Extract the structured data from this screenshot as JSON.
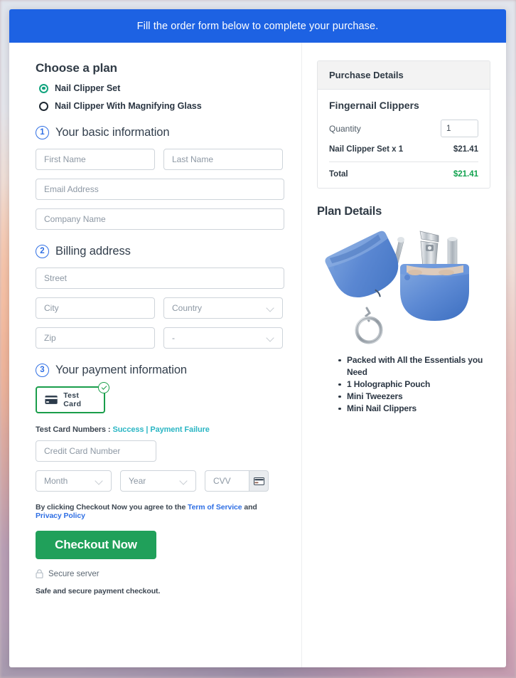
{
  "banner": {
    "text": "Fill the order form below to complete your purchase."
  },
  "colors": {
    "banner_blue": "#1d62e3",
    "accent_blue": "#2f6fe4",
    "success_green": "#20a05a",
    "total_green": "#12a34f",
    "radio_green": "#12a47e",
    "link_teal": "#2bb6c4",
    "tile_border_green": "#1a9e4b"
  },
  "plan": {
    "title": "Choose a plan",
    "options": [
      {
        "label": "Nail Clipper Set",
        "selected": true
      },
      {
        "label": "Nail Clipper With Magnifying Glass",
        "selected": false
      }
    ]
  },
  "step1": {
    "number": "1",
    "label": "Your basic information",
    "fields": {
      "first_name": "First Name",
      "last_name": "Last Name",
      "email": "Email Address",
      "company": "Company Name"
    }
  },
  "step2": {
    "number": "2",
    "label": "Billing address",
    "fields": {
      "street": "Street",
      "city": "City",
      "country": "Country",
      "zip": "Zip",
      "state": "-"
    }
  },
  "step3": {
    "number": "3",
    "label": "Your payment information",
    "card_tile": {
      "label": "Test Card",
      "icon": "credit-card-icon",
      "selected": true,
      "check_icon": "check-circle-icon"
    },
    "test_numbers": {
      "prefix": "Test Card Numbers :",
      "success_link": "Success",
      "separator": "|",
      "failure_link": "Payment Failure"
    },
    "fields": {
      "credit_card_number": "Credit Card Number",
      "month": "Month",
      "year": "Year",
      "cvv": "CVV"
    },
    "cvv_icon": "credit-card-icon"
  },
  "footer": {
    "legal_prefix": "By clicking Checkout Now you agree to the",
    "terms_link": "Term of Service",
    "legal_and": "and",
    "privacy_link": "Privacy Policy",
    "checkout_label": "Checkout Now",
    "secure_icon": "lock-icon",
    "secure_text": "Secure server",
    "safe_note": "Safe and secure payment checkout."
  },
  "purchase": {
    "header": "Purchase Details",
    "product_name": "Fingernail Clippers",
    "quantity_label": "Quantity",
    "quantity_value": "1",
    "line_item_label": "Nail Clipper Set x 1",
    "line_item_amount": "$21.41",
    "total_label": "Total",
    "total_amount": "$21.41"
  },
  "plan_details": {
    "title": "Plan Details",
    "image_name": "nail-clipper-set-product-image",
    "features": [
      "Packed with All the Essentials you Need",
      "1 Holographic Pouch",
      "Mini Tweezers",
      "Mini Nail Clippers"
    ]
  }
}
